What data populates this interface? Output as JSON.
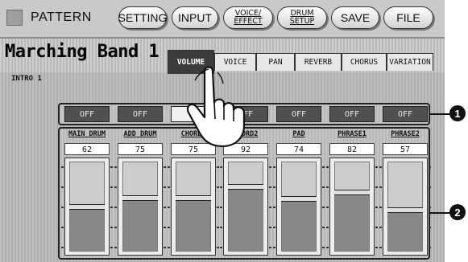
{
  "header": {
    "pattern_label": "PATTERN",
    "buttons": [
      {
        "id": "setting",
        "label": "SETTING"
      },
      {
        "id": "input",
        "label": "INPUT"
      },
      {
        "id": "voice-effect",
        "line1": "VOICE/",
        "line2": "EFFECT"
      },
      {
        "id": "drum-setup",
        "line1": "DRUM",
        "line2": "SETUP"
      },
      {
        "id": "save",
        "label": "SAVE"
      },
      {
        "id": "file",
        "label": "FILE"
      }
    ]
  },
  "style_title": "Marching Band 1",
  "section_label": "INTRO 1",
  "tabs": [
    "VOLUME",
    "VOICE",
    "PAN",
    "REVERB",
    "CHORUS",
    "VARIATION"
  ],
  "active_tab": "VOLUME",
  "channels": [
    {
      "name": "MAIN DRUM",
      "mute": "OFF",
      "value": 62,
      "level": 0.49
    },
    {
      "name": "ADD DRUM",
      "mute": "OFF",
      "value": 75,
      "level": 0.59
    },
    {
      "name": "CHORD1",
      "mute": "ON",
      "value": 75,
      "level": 0.59
    },
    {
      "name": "CHORD2",
      "mute": "OFF",
      "value": 92,
      "level": 0.72
    },
    {
      "name": "PAD",
      "mute": "OFF",
      "value": 74,
      "level": 0.58
    },
    {
      "name": "PHRASE1",
      "mute": "OFF",
      "value": 82,
      "level": 0.65
    },
    {
      "name": "PHRASE2",
      "mute": "OFF",
      "value": 57,
      "level": 0.45
    }
  ],
  "callouts": [
    "1",
    "2"
  ]
}
